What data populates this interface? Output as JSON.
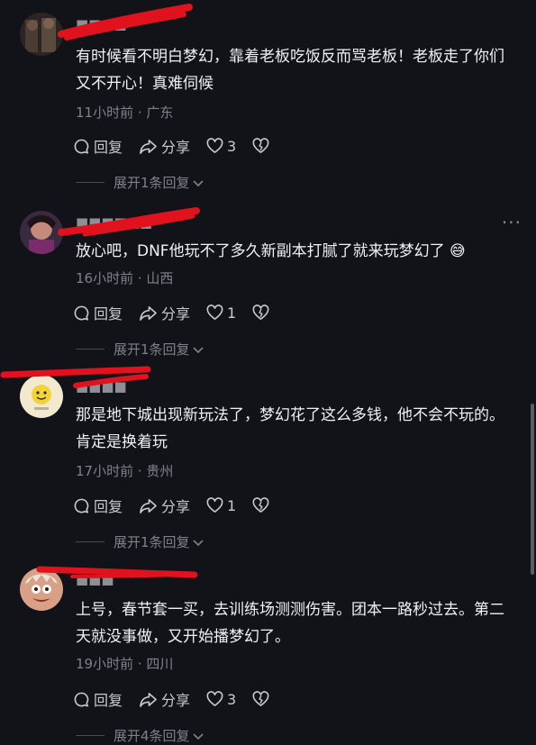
{
  "comments": [
    {
      "text": "有时候看不明白梦幻，靠着老板吃饭反而骂老板！老板走了你们又不开心！真难伺候",
      "time": "11小时前",
      "location": "广东",
      "reply_label": "回复",
      "share_label": "分享",
      "likes": "3",
      "expand_label": "展开1条回复"
    },
    {
      "text": "放心吧，DNF他玩不了多久新副本打腻了就来玩梦幻了 😅",
      "time": "16小时前",
      "location": "山西",
      "reply_label": "回复",
      "share_label": "分享",
      "likes": "1",
      "expand_label": "展开1条回复"
    },
    {
      "text": "那是地下城出现新玩法了，梦幻花了这么多钱，他不会不玩的。肯定是换着玩",
      "time": "17小时前",
      "location": "贵州",
      "reply_label": "回复",
      "share_label": "分享",
      "likes": "1",
      "expand_label": "展开1条回复"
    },
    {
      "text": "上号，春节套一买，去训练场测测伤害。团本一路秒过去。第二天就没事做，又开始播梦幻了。",
      "time": "19小时前",
      "location": "四川",
      "reply_label": "回复",
      "share_label": "分享",
      "likes": "3",
      "expand_label": "展开4条回复"
    }
  ],
  "meta_separator": " · ",
  "colors": {
    "background": "#121319",
    "redaction": "#e0121d",
    "secondary_text": "#7f8089"
  },
  "icons": [
    "reply-icon",
    "share-icon",
    "heart-icon",
    "broken-heart-icon",
    "chevron-down-icon",
    "more-icon"
  ]
}
